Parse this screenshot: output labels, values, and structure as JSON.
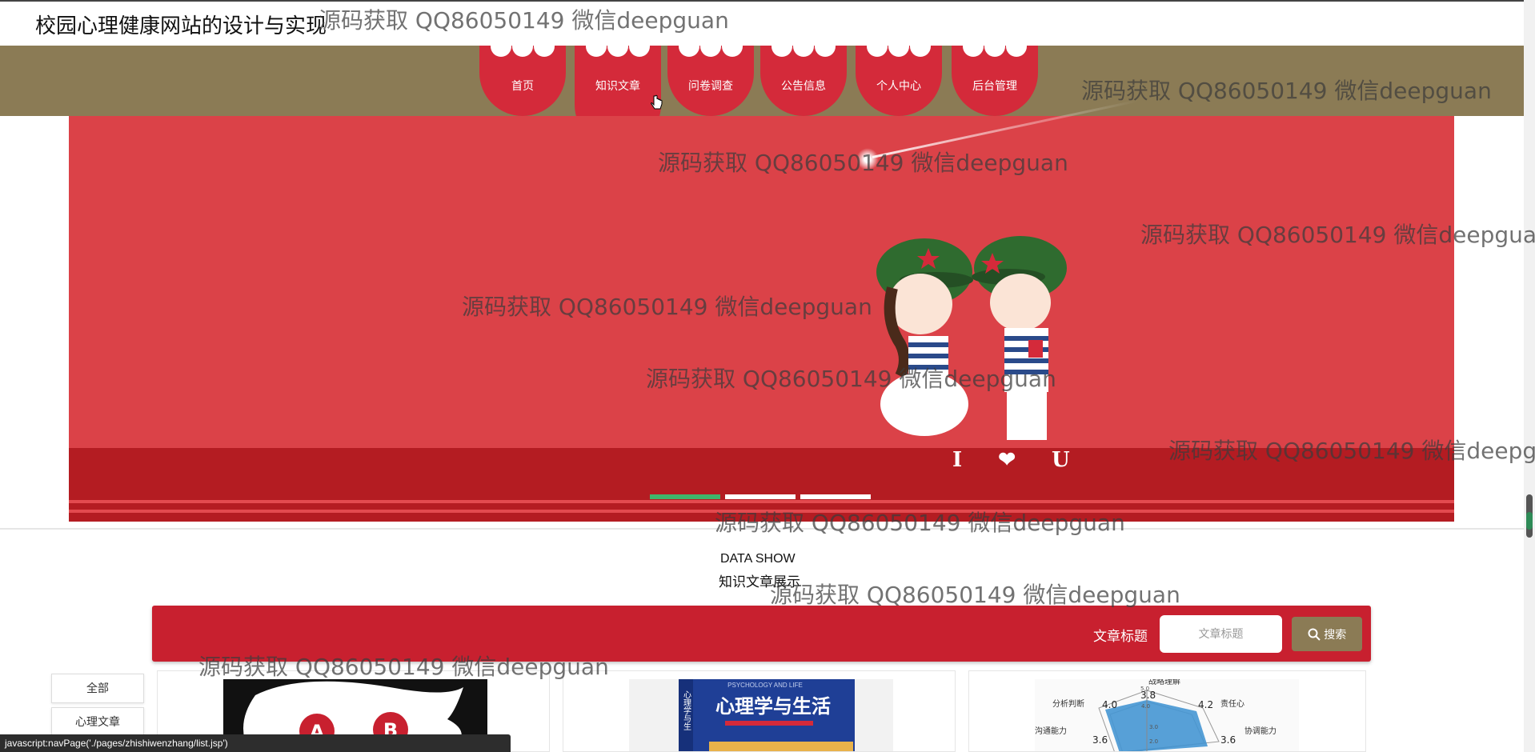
{
  "site": {
    "title": "校园心理健康网站的设计与实现"
  },
  "nav": {
    "items": [
      {
        "label": "首页"
      },
      {
        "label": "知识文章"
      },
      {
        "label": "问卷调查"
      },
      {
        "label": "公告信息"
      },
      {
        "label": "个人中心"
      },
      {
        "label": "后台管理"
      }
    ]
  },
  "banner": {
    "text": "I ❤ U"
  },
  "section": {
    "title_en": "DATA SHOW",
    "title_cn": "知识文章展示"
  },
  "search": {
    "label": "文章标题",
    "placeholder": "文章标题",
    "button_label": "搜索"
  },
  "categories": [
    {
      "label": "全部"
    },
    {
      "label": "心理文章"
    }
  ],
  "cards": [
    {
      "image": "abo-blood-type",
      "letters": [
        "A",
        "B"
      ]
    },
    {
      "image": "book-cover",
      "title": "心理学与生活",
      "spine": "心理学与生",
      "sub": "PSYCHOLOGY AND LIFE"
    },
    {
      "image": "radar-chart",
      "labels": [
        "战略理解",
        "责任心",
        "协调能力",
        "沟通能力",
        "分析判断"
      ],
      "values": [
        "3.8",
        "4.2",
        "3.6",
        "3.6",
        "4.0"
      ],
      "ticks": [
        "5.0",
        "4.0",
        "3.0",
        "2.0"
      ]
    }
  ],
  "status": {
    "url": "javascript:navPage('./pages/zhishiwenzhang/list.jsp')"
  },
  "watermark": "源码获取 QQ86050149 微信deepguan"
}
